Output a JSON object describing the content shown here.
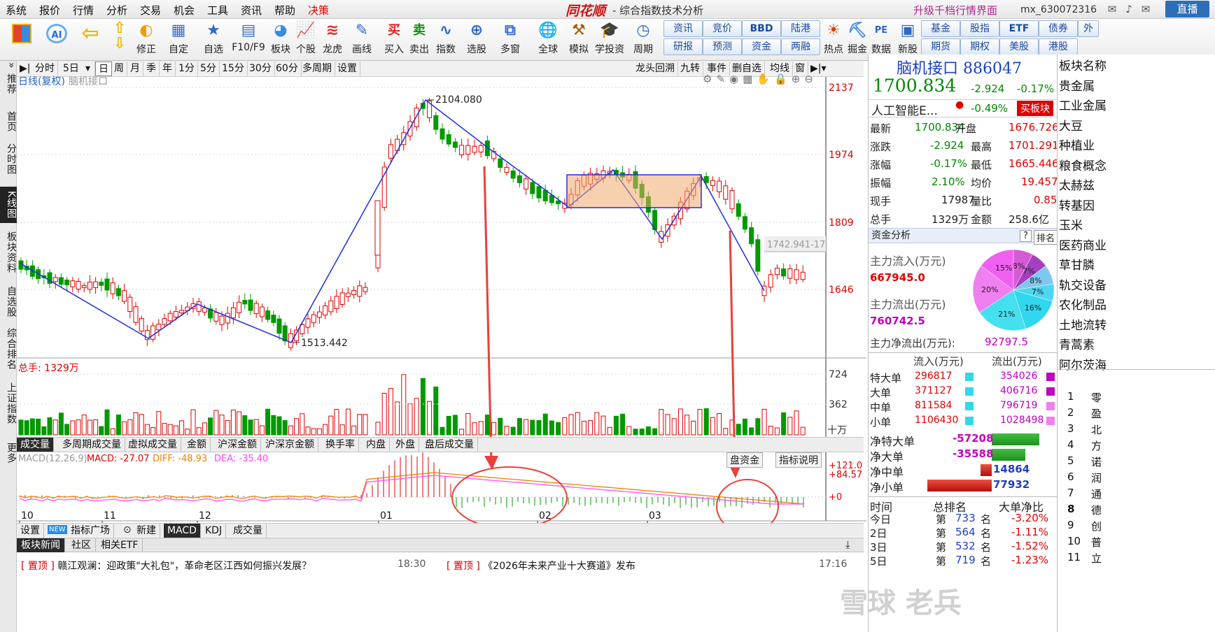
{
  "menu": [
    "系统",
    "报价",
    "行情",
    "分析",
    "交易",
    "机会",
    "工具",
    "资讯",
    "帮助"
  ],
  "menu_highlight": "决策",
  "brand": "同花顺",
  "window_title": "- 综合指数技术分析",
  "upgrade_link": "升级千档行情界面",
  "user_id": "mx_630072316",
  "live_button": "直播",
  "toolbar": [
    "",
    "",
    "修正",
    "自定",
    "自选",
    "F10/F9",
    "板块",
    "个股",
    "龙虎",
    "画线",
    "买入",
    "卖出",
    "指数",
    "选股",
    "多窗",
    "全球",
    "模拟",
    "学投资",
    "周期"
  ],
  "toolbar_right": [
    [
      "资讯",
      "研报"
    ],
    [
      "竞价",
      "预测"
    ],
    [
      "BBD",
      "资金"
    ],
    [
      "陆港",
      "两融"
    ]
  ],
  "toolbar_right2": [
    "热点",
    "掘金",
    "数据",
    "新股"
  ],
  "toolbar_right3": [
    [
      "基金",
      "期货"
    ],
    [
      "股指",
      "期权"
    ],
    [
      "ETF",
      "美股"
    ],
    [
      "债券",
      "港股"
    ]
  ],
  "toolbar_more": "外",
  "sidebar": [
    "推荐",
    "首页",
    "分时图",
    "K线图",
    "板块资料",
    "自选股",
    "综合排名",
    "上证指数",
    "更多"
  ],
  "period_tabs": [
    "分时",
    "5日",
    "日",
    "周",
    "月",
    "季",
    "年",
    "1分",
    "5分",
    "15分",
    "30分",
    "60分",
    "多周期",
    "设置"
  ],
  "period_right": [
    "龙头回溯",
    "九转",
    "事件",
    "删自选",
    "均线",
    "窗"
  ],
  "kline_label": "日线(复权)",
  "kline_sub": "脑机接口",
  "chart_data": {
    "type": "candlestick",
    "y_ticks": [
      2137,
      1974,
      1809,
      1646
    ],
    "x_ticks": [
      "10",
      "11",
      "12",
      "01",
      "02",
      "03"
    ],
    "annotations": [
      "2104.080",
      "1513.442",
      "1742.941-17"
    ],
    "vol_label": "总手: 1329万",
    "vol_ticks": [
      "724",
      "362"
    ],
    "vol_unit": "十万",
    "macd_label": "MACD(12,26,9)",
    "macd": "MACD: -27.07",
    "diff": "DIFF: -48.93",
    "dea": "DEA: -35.40",
    "macd_ticks": [
      "+121.0",
      "+84.57",
      "+0"
    ]
  },
  "vol_tabs": [
    "成交量",
    "多周期成交量",
    "虚拟成交量",
    "金额",
    "沪深金额",
    "沪深京金额",
    "换手率",
    "内盘",
    "外盘",
    "盘后成交量"
  ],
  "macd_btns": [
    "盘资金",
    "指标说明"
  ],
  "ind_tabs": [
    "设置",
    "指标广场",
    "新建",
    "MACD",
    "KDJ",
    "成交量"
  ],
  "ind_new_badge": "NEW",
  "news_tabs": [
    "板块新闻",
    "社区",
    "相关ETF"
  ],
  "news": [
    {
      "tag": "置顶",
      "text": "赣江观澜：迎政策\"大礼包\"，革命老区江西如何振兴发展？",
      "time": "18:30"
    },
    {
      "tag": "置顶",
      "text": "《2026年未来产业十大赛道》发布",
      "time": "17:16"
    }
  ],
  "quote": {
    "name": "脑机接口 886047",
    "price": "1700.834",
    "change": "-2.924",
    "pct": "-0.17%",
    "related": "人工智能E...",
    "related_pct": "-0.49%",
    "buy_btn": "买板块",
    "rows": [
      [
        "最新",
        "1700.834",
        "开盘",
        "1676.726"
      ],
      [
        "涨跌",
        "-2.924",
        "最高",
        "1701.291"
      ],
      [
        "涨幅",
        "-0.17%",
        "最低",
        "1665.446"
      ],
      [
        "振幅",
        "2.10%",
        "均价",
        "19.457"
      ],
      [
        "现手",
        "17987",
        "量比",
        "0.85"
      ],
      [
        "总手",
        "1329万",
        "金额",
        "258.6亿"
      ]
    ]
  },
  "fund": {
    "title": "资金分析",
    "help": "?",
    "rank_btn": "排名",
    "inflow_label": "主力流入(万元)",
    "inflow": "667945.0",
    "outflow_label": "主力流出(万元)",
    "outflow": "760742.5",
    "net_label": "主力净流出(万元):",
    "net": "92797.5",
    "pie": [
      {
        "pct": "8%",
        "color": "#d65ad6"
      },
      {
        "pct": "7%",
        "color": "#a43fbf"
      },
      {
        "pct": "8%",
        "color": "#7fc7ef"
      },
      {
        "pct": "7%",
        "color": "#4fd6f0"
      },
      {
        "pct": "16%",
        "color": "#2fd7ef"
      },
      {
        "pct": "21%",
        "color": "#44e0f0"
      },
      {
        "pct": "20%",
        "color": "#f07ff0"
      },
      {
        "pct": "15%",
        "color": "#f060f0"
      }
    ],
    "flow_head": [
      "流入(万元)",
      "流出(万元)"
    ],
    "flow_rows": [
      [
        "特大单",
        "296817",
        "354026"
      ],
      [
        "大单",
        "371127",
        "406716"
      ],
      [
        "中单",
        "811584",
        "796719"
      ],
      [
        "小单",
        "1106430",
        "1028498"
      ]
    ],
    "net_rows": [
      [
        "净特大单",
        "-57208"
      ],
      [
        "净大单",
        "-35588"
      ],
      [
        "净中单",
        "14864"
      ],
      [
        "净小单",
        "77932"
      ]
    ],
    "rank_head": [
      "时间",
      "总排名",
      "大单净比"
    ],
    "rank_rows": [
      [
        "今日",
        "第",
        "733",
        "名",
        "-3.20%"
      ],
      [
        "2日",
        "第",
        "564",
        "名",
        "-1.11%"
      ],
      [
        "3日",
        "第",
        "532",
        "名",
        "-1.52%"
      ],
      [
        "5日",
        "第",
        "719",
        "名",
        "-1.23%"
      ]
    ]
  },
  "far_right": [
    "板块名称",
    "贵金属",
    "工业金属",
    "大豆",
    "种植业",
    "粮食概念",
    "太赫兹",
    "转基因",
    "玉米",
    "医药商业",
    "草甘膦",
    "轨交设备",
    "农化制品",
    "土地流转",
    "青蒿素",
    "阿尔茨海"
  ],
  "far_right_nums": [
    "1",
    "2",
    "3",
    "4",
    "5",
    "6",
    "7",
    "8",
    "9",
    "10",
    "11"
  ],
  "far_right_chars": [
    "零",
    "盈",
    "北",
    "方",
    "诺",
    "润",
    "通",
    "德",
    "创",
    "普",
    "立"
  ],
  "watermark": "雪球 老兵"
}
